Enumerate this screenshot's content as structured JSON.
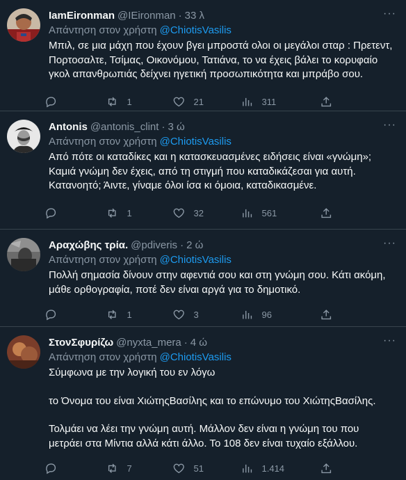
{
  "tweets": [
    {
      "name": "IamEironman",
      "handle": "@IEironman",
      "time": "33 λ",
      "reply_prefix": "Απάντηση στον χρήστη",
      "reply_to": "@ChiotisVasilis",
      "paragraphs": [
        "Μπιλ, σε μια μάχη που έχουν βγει μπροστά ολοι οι μεγάλοι σταρ : Πρετεντ, Πορτοσαλτε, Τσίμας, Οικονόμου, Τατιάνα, το να έχεις βάλει το κορυφαίο γκολ απανθρωπιάς δείχνει ηγετική προσωπικότητα και μπράβο σου."
      ],
      "replies": "",
      "retweets": "1",
      "likes": "21",
      "views": "311"
    },
    {
      "name": "Antonis",
      "handle": "@antonis_clint",
      "time": "3 ώ",
      "reply_prefix": "Απάντηση στον χρήστη",
      "reply_to": "@ChiotisVasilis",
      "paragraphs": [
        "Από πότε οι καταδίκες και η κατασκευασμένες ειδήσεις είναι «γνώμη»; Καμιά γνώμη δεν έχεις, από τη στιγμή που καταδικάζεσαι για αυτή. Κατανοητό; Άιντε, γίναμε όλοι ίσα κι όμοια, καταδικασμένε."
      ],
      "replies": "",
      "retweets": "1",
      "likes": "32",
      "views": "561"
    },
    {
      "name": "Αραχώβης τρία.",
      "handle": "@pdiveris",
      "time": "2 ώ",
      "reply_prefix": "Απάντηση στον χρήστη",
      "reply_to": "@ChiotisVasilis",
      "paragraphs": [
        "Πολλή σημασία δίνουν στην αφεντιά σου και στη γνώμη σου. Κάτι ακόμη, μάθε ορθογραφία, ποτέ δεν είναι αργά για το δημοτικό."
      ],
      "replies": "",
      "retweets": "1",
      "likes": "3",
      "views": "96"
    },
    {
      "name": "ΣτονΣφυρίζω",
      "handle": "@nyxta_mera",
      "time": "4 ώ",
      "reply_prefix": "Απάντηση στον χρήστη",
      "reply_to": "@ChiotisVasilis",
      "paragraphs": [
        "Σύμφωνα με την λογική του εν λόγω",
        "το Όνομα του είναι ΧιώτηςΒασίλης και το επώνυμο του ΧιώτηςΒασίλης.",
        "Τολμάει να λέει την γνώμη αυτή. Μάλλον δεν είναι η γνώμη του που μετράει στα Μίντια αλλά κάτι άλλο. Το 108 δεν είναι τυχαίο εξάλλου."
      ],
      "replies": "",
      "retweets": "7",
      "likes": "51",
      "views": "1.414"
    }
  ],
  "icons": {
    "reply": "speech-bubble-icon",
    "retweet": "retweet-arrows-icon",
    "like": "heart-icon",
    "views": "bar-chart-icon",
    "share": "share-upload-icon",
    "more": "three-dots-icon"
  },
  "colors": {
    "background": "#15202b",
    "text": "#f7f9f9",
    "muted": "#8b98a5",
    "accent": "#1d9bf0",
    "divider": "#38444d"
  }
}
